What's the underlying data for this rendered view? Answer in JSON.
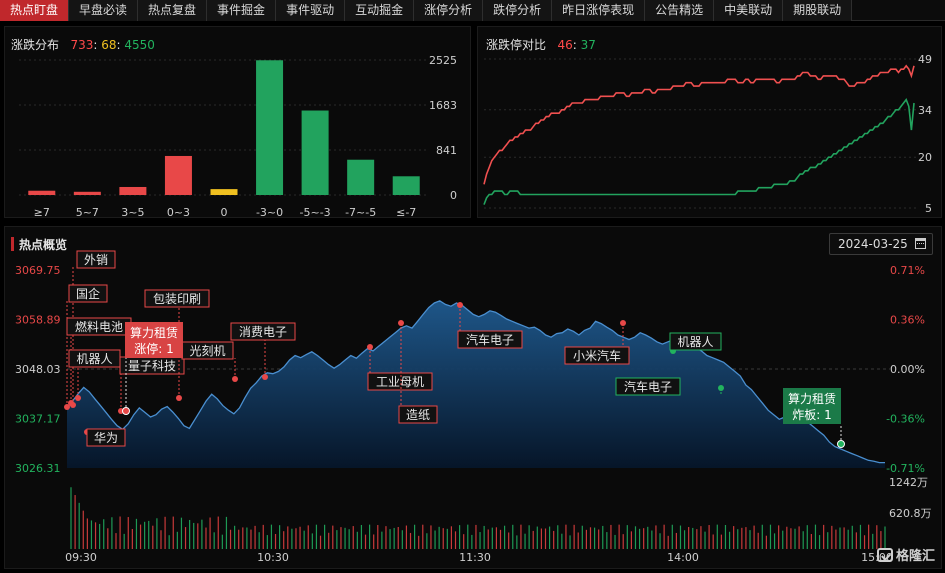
{
  "nav": {
    "tabs": [
      "热点盯盘",
      "早盘必读",
      "热点复盘",
      "事件掘金",
      "事件驱动",
      "互动掘金",
      "涨停分析",
      "跌停分析",
      "昨日涨停表现",
      "公告精选",
      "中美联动",
      "期股联动"
    ],
    "active_index": 0
  },
  "dist_panel": {
    "title": "涨跌分布",
    "up": "733",
    "flat": "68",
    "down": "4550",
    "sep": ":"
  },
  "ratio_panel": {
    "title": "涨跌停对比",
    "limit_up": "46",
    "limit_down": "37",
    "sep": ":"
  },
  "overview": {
    "title": "热点概览",
    "date": "2024-03-25",
    "x_ticks": [
      "09:30",
      "10:30",
      "11:30",
      "14:00",
      "15:00"
    ],
    "y_left": [
      "3069.75",
      "3058.89",
      "3048.03",
      "3037.17",
      "3026.31"
    ],
    "y_right": [
      "0.71%",
      "0.36%",
      "0.00%",
      "-0.36%",
      "-0.71%"
    ],
    "vol_labels": [
      "1242万",
      "620.8万"
    ],
    "tags": [
      {
        "text": "外销",
        "kind": "red"
      },
      {
        "text": "国企",
        "kind": "red"
      },
      {
        "text": "燃料电池",
        "kind": "red"
      },
      {
        "text": "机器人",
        "kind": "red"
      },
      {
        "text": "华为",
        "kind": "red"
      },
      {
        "text": "量子科技",
        "kind": "red"
      },
      {
        "text": "包装印刷",
        "kind": "red"
      },
      {
        "text": "光刻机",
        "kind": "red"
      },
      {
        "text": "消费电子",
        "kind": "red"
      },
      {
        "text": "工业母机",
        "kind": "red"
      },
      {
        "text": "造纸",
        "kind": "red"
      },
      {
        "text": "汽车电子",
        "kind": "red"
      },
      {
        "text": "小米汽车",
        "kind": "red"
      },
      {
        "text": "机器人",
        "kind": "green"
      },
      {
        "text": "汽车电子",
        "kind": "green"
      }
    ],
    "callouts": [
      {
        "line1": "算力租赁",
        "line2": "涨停: 1",
        "kind": "red"
      },
      {
        "line1": "算力租赁",
        "line2": "炸板: 1",
        "kind": "green"
      }
    ]
  },
  "logo": {
    "text": "格隆汇"
  },
  "chart_data": [
    {
      "type": "bar",
      "categories": [
        "≥7",
        "5~7",
        "3~5",
        "0~3",
        "0",
        "-3~0",
        "-5~-3",
        "-7~-5",
        "≤-7"
      ],
      "values": [
        80,
        60,
        150,
        730,
        110,
        2520,
        1580,
        660,
        350
      ],
      "colors": [
        "#e84848",
        "#e84848",
        "#e84848",
        "#e84848",
        "#f0c020",
        "#22a35e",
        "#22a35e",
        "#22a35e",
        "#22a35e"
      ],
      "yticks": [
        "2525",
        "1683",
        "841",
        "0"
      ],
      "ylim": [
        0,
        2525
      ],
      "grid": true
    },
    {
      "type": "line",
      "yticks": [
        "49",
        "34",
        "20",
        "5"
      ],
      "ylim": [
        5,
        49
      ],
      "series": [
        {
          "color": "#f05050",
          "values": [
            12,
            15,
            17,
            19,
            20,
            21,
            22,
            22,
            23,
            24,
            25,
            25,
            26,
            26,
            27,
            27,
            28,
            28,
            28,
            29,
            30,
            30,
            31,
            31,
            32,
            32,
            33,
            33,
            33,
            33,
            34,
            34,
            35,
            35,
            36,
            36,
            36,
            36,
            36,
            37,
            37,
            37,
            37,
            37,
            37,
            38,
            38,
            38,
            38,
            38,
            38,
            39,
            39,
            39,
            39,
            38,
            38,
            39,
            39,
            39,
            39,
            39,
            40,
            40,
            40,
            39,
            39,
            40,
            40,
            40,
            40,
            40,
            40,
            41,
            41,
            41,
            41,
            41,
            42,
            42,
            42,
            41,
            41,
            41,
            42,
            42,
            42,
            42,
            42,
            42,
            42,
            42,
            42,
            42,
            43,
            43,
            43,
            43,
            42,
            42,
            42,
            43,
            43,
            42,
            42,
            43,
            43,
            43,
            43,
            43,
            43,
            43,
            43,
            42,
            42,
            43,
            43,
            43,
            43,
            43,
            43,
            44,
            44,
            45,
            45,
            45,
            44,
            44,
            44,
            43,
            43,
            44,
            44,
            44,
            44,
            44,
            44,
            43,
            43,
            43,
            42,
            41,
            41,
            41,
            42,
            42,
            42,
            42,
            43,
            43,
            44,
            44,
            44,
            45,
            45,
            45,
            45,
            46,
            46,
            46,
            45,
            46,
            46,
            47,
            46,
            44,
            47
          ]
        },
        {
          "color": "#22a35e",
          "values": [
            6,
            8,
            9,
            9,
            10,
            10,
            10,
            10,
            9,
            9,
            10,
            10,
            10,
            10,
            9,
            9,
            9,
            9,
            9,
            9,
            9,
            9,
            9,
            9,
            9,
            9,
            9,
            9,
            9,
            9,
            9,
            9,
            9,
            9,
            9,
            9,
            9,
            9,
            9,
            9,
            9,
            9,
            9,
            9,
            9,
            9,
            9,
            9,
            9,
            9,
            9,
            9,
            9,
            9,
            9,
            9,
            9,
            9,
            9,
            9,
            9,
            9,
            9,
            9,
            9,
            9,
            9,
            9,
            9,
            9,
            9,
            9,
            9,
            9,
            9,
            9,
            9,
            9,
            9,
            9,
            9,
            9,
            9,
            9,
            9,
            9,
            9,
            9,
            9,
            9,
            9,
            9,
            9,
            9,
            9,
            9,
            9,
            9,
            10,
            10,
            10,
            10,
            10,
            10,
            10,
            10,
            11,
            11,
            11,
            11,
            11,
            11,
            12,
            12,
            12,
            12,
            12,
            12,
            13,
            13,
            13,
            14,
            15,
            15,
            16,
            16,
            17,
            17,
            17,
            18,
            18,
            19,
            19,
            20,
            20,
            21,
            21,
            22,
            22,
            23,
            23,
            24,
            24,
            25,
            25,
            26,
            26,
            27,
            27,
            28,
            28,
            29,
            29,
            30,
            30,
            31,
            32,
            32,
            33,
            34,
            34,
            35,
            36,
            37,
            35,
            28,
            36
          ]
        }
      ]
    },
    {
      "type": "area",
      "ylim": [
        3026.31,
        3069.75
      ],
      "x_ticks": [
        "09:30",
        "10:30",
        "11:30",
        "14:00",
        "15:00"
      ],
      "values": [
        3039.5,
        3041.0,
        3042.6,
        3044.0,
        3043.0,
        3041.5,
        3040.0,
        3038.5,
        3037.0,
        3035.6,
        3034.8,
        3036.0,
        3038.0,
        3039.5,
        3038.5,
        3037.5,
        3038.0,
        3039.2,
        3039.8,
        3038.6,
        3037.2,
        3035.6,
        3035.0,
        3037.0,
        3039.0,
        3041.0,
        3042.5,
        3041.5,
        3040.0,
        3039.0,
        3038.2,
        3039.5,
        3041.8,
        3043.8,
        3045.0,
        3046.5,
        3047.2,
        3047.0,
        3047.5,
        3048.5,
        3050.0,
        3051.0,
        3050.5,
        3051.2,
        3051.8,
        3051.0,
        3050.0,
        3049.0,
        3048.2,
        3049.0,
        3050.0,
        3051.0,
        3050.4,
        3051.5,
        3052.5,
        3052.0,
        3053.0,
        3054.0,
        3055.0,
        3056.0,
        3057.0,
        3057.5,
        3057.0,
        3058.5,
        3060.0,
        3061.5,
        3062.5,
        3063.0,
        3062.2,
        3061.8,
        3062.5,
        3062.0,
        3061.0,
        3060.0,
        3059.5,
        3060.0,
        3060.8,
        3060.5,
        3059.8,
        3059.0,
        3058.5,
        3058.0,
        3057.5,
        3057.0,
        3057.2,
        3056.5,
        3055.5,
        3055.0,
        3055.8,
        3056.0,
        3056.8,
        3056.3,
        3055.5,
        3056.5,
        3057.0,
        3058.5,
        3058.0,
        3057.2,
        3056.5,
        3055.5,
        3055.0,
        3054.5,
        3055.0,
        3056.0,
        3055.5,
        3054.8,
        3054.0,
        3053.5,
        3054.0,
        3054.5,
        3054.0,
        3053.2,
        3052.5,
        3052.8,
        3052.0,
        3051.0,
        3050.5,
        3050.0,
        3049.5,
        3048.5,
        3047.5,
        3046.5,
        3044.5,
        3043.5,
        3042.0,
        3040.5,
        3039.0,
        3038.0,
        3037.0,
        3037.5,
        3038.5,
        3038.0,
        3037.5,
        3036.5,
        3035.5,
        3034.5,
        3033.5,
        3032.0,
        3031.0,
        3030.5,
        3030.0,
        3029.5,
        3029.0,
        3028.5,
        3028.0,
        3027.8,
        3027.5,
        3027.5
      ]
    }
  ]
}
